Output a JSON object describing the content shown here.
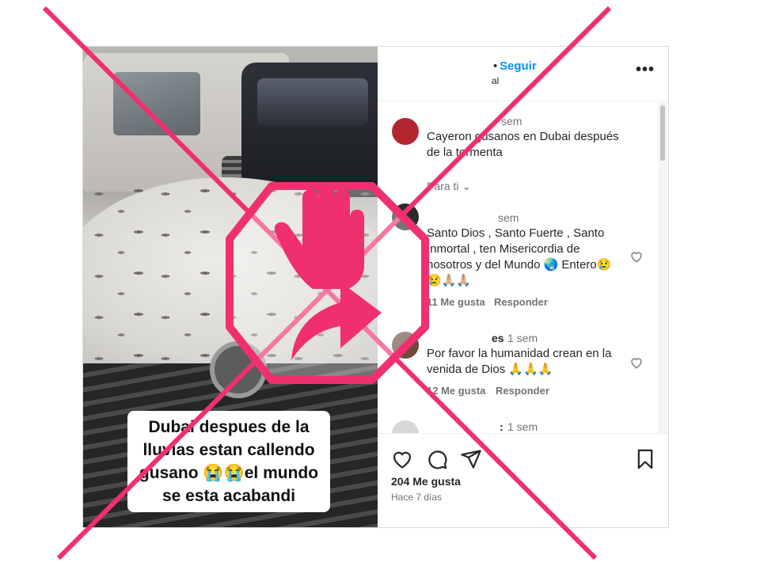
{
  "video": {
    "caption_lines": [
      "Dubai despues de la",
      "lluvias estan callendo",
      "gusano 😭😭el mundo",
      "se esta acabandi"
    ]
  },
  "header": {
    "follow_label": "Seguir",
    "dot": "•",
    "sub_fragment": "al",
    "more_label": "•••",
    "more_icon": "more-horizontal-icon"
  },
  "comments": [
    {
      "time": "sem",
      "text_lines": [
        "Cayeron gusanos en Dubai después",
        "de la tormenta"
      ],
      "translation_label": "Para ti",
      "avatar_color": "#b3262f"
    },
    {
      "time": "sem",
      "text_lines": [
        "Santo Dios , Santo Fuerte , Santo",
        "Inmortal , ten Misericordia de",
        "nosotros y del Mundo 🌏 Entero😢",
        "😢🙏🏼🙏🏼"
      ],
      "likes": "11 Me gusta",
      "reply": "Responder",
      "avatar_color": "#2b2b2b"
    },
    {
      "user_fragment": "es",
      "time": "1 sem",
      "text_lines": [
        "Por favor la humanidad crean en la",
        "venida de Dios 🙏🙏🙏"
      ],
      "likes": "12 Me gusta",
      "reply": "Responder",
      "avatar_color": "#6d4b3b"
    },
    {
      "user_fragment": ":",
      "time": "1 sem",
      "avatar_color": "#d8d8d8"
    }
  ],
  "actions": {
    "like_icon": "heart-icon",
    "comment_icon": "comment-icon",
    "share_icon": "share-icon",
    "save_icon": "bookmark-icon",
    "likes": "204 Me gusta",
    "date": "Hace 7 días"
  },
  "overlay": {
    "color": "#f0306e",
    "icon": "stop-hand-share-icon"
  }
}
